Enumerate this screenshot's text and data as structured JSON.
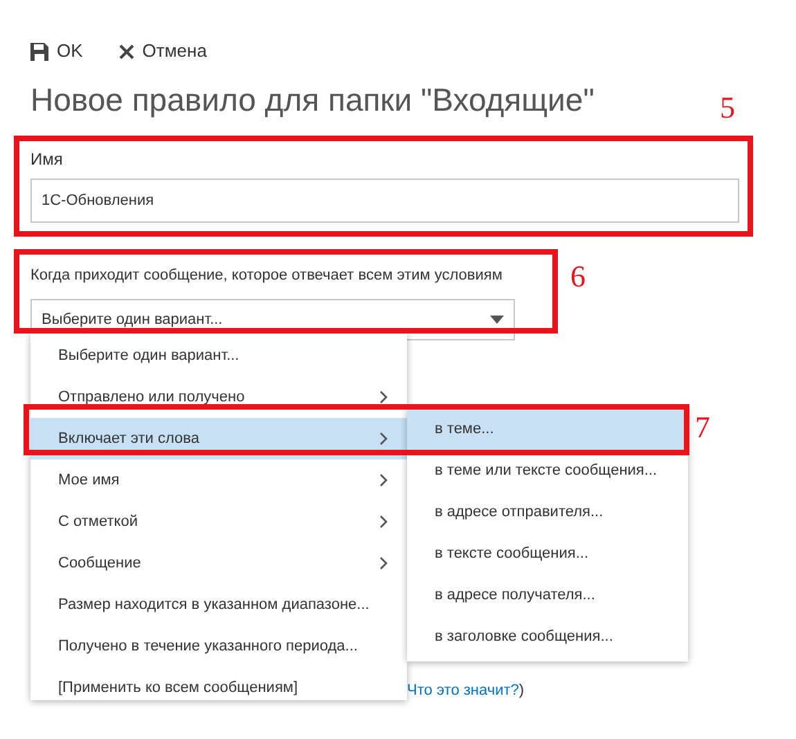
{
  "toolbar": [
    {
      "kind": "save",
      "label": "OK"
    },
    {
      "kind": "cancel",
      "label": "Отмена"
    }
  ],
  "title": "Новое правило для папки \"Входящие\"",
  "title_annotation": "5",
  "name_field": {
    "label": "Имя",
    "value": "1С-Обновления"
  },
  "condition_field": {
    "label": "Когда приходит сообщение, которое отвечает всем этим условиям",
    "value": "Выберите один вариант...",
    "annotation": "6"
  },
  "dropdown_menu": [
    {
      "label": "Выберите один вариант...",
      "has_submenu": false,
      "selected": false
    },
    {
      "label": "Отправлено или получено",
      "has_submenu": true,
      "selected": false
    },
    {
      "label": "Включает эти слова",
      "has_submenu": true,
      "selected": true
    },
    {
      "label": "Мое имя",
      "has_submenu": true,
      "selected": false
    },
    {
      "label": "С отметкой",
      "has_submenu": true,
      "selected": false
    },
    {
      "label": "Сообщение",
      "has_submenu": true,
      "selected": false
    },
    {
      "label": "Размер находится в указанном диапазоне...",
      "has_submenu": false,
      "selected": false
    },
    {
      "label": "Получено в течение указанного периода...",
      "has_submenu": false,
      "selected": false
    },
    {
      "label": "[Применить ко всем сообщениям]",
      "has_submenu": false,
      "selected": false
    }
  ],
  "submenu": [
    {
      "label": "в теме...",
      "selected": true
    },
    {
      "label": "в теме или тексте сообщения...",
      "selected": false
    },
    {
      "label": "в адресе отправителя...",
      "selected": false
    },
    {
      "label": "в тексте сообщения...",
      "selected": false
    },
    {
      "label": "в адресе получателя...",
      "selected": false
    },
    {
      "label": "в заголовке сообщения...",
      "selected": false
    }
  ],
  "menu_annotation": "7",
  "help_link": {
    "text": "Что это значит?",
    "after": ")"
  }
}
